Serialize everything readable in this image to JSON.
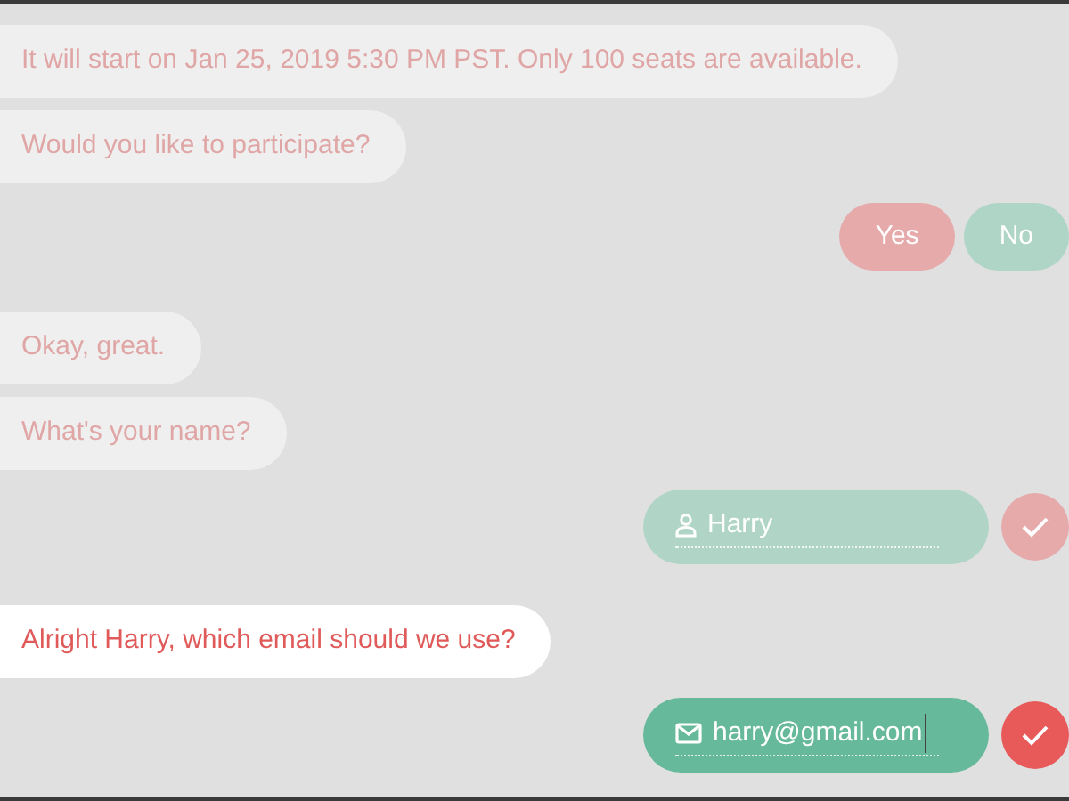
{
  "conversation": [
    {
      "kind": "bot",
      "active": false,
      "lines": [
        "It will start on Jan 25, 2019 5:30 PM PST. Only 100 seats are available.",
        "Would you like to participate?"
      ]
    },
    {
      "kind": "choices",
      "options": [
        {
          "label": "Yes",
          "color": "#e6aaaa"
        },
        {
          "label": "No",
          "color": "#afd5c6"
        }
      ]
    },
    {
      "kind": "bot",
      "active": false,
      "lines": [
        "Okay, great.",
        "What's your name?"
      ]
    },
    {
      "kind": "input",
      "field": {
        "kind": "name",
        "value": "Harry",
        "focused": false
      }
    },
    {
      "kind": "bot",
      "active": true,
      "lines": [
        "Alright Harry, which email should we use?"
      ]
    },
    {
      "kind": "input",
      "field": {
        "kind": "email",
        "value": "harry@gmail.com",
        "focused": true
      }
    }
  ]
}
